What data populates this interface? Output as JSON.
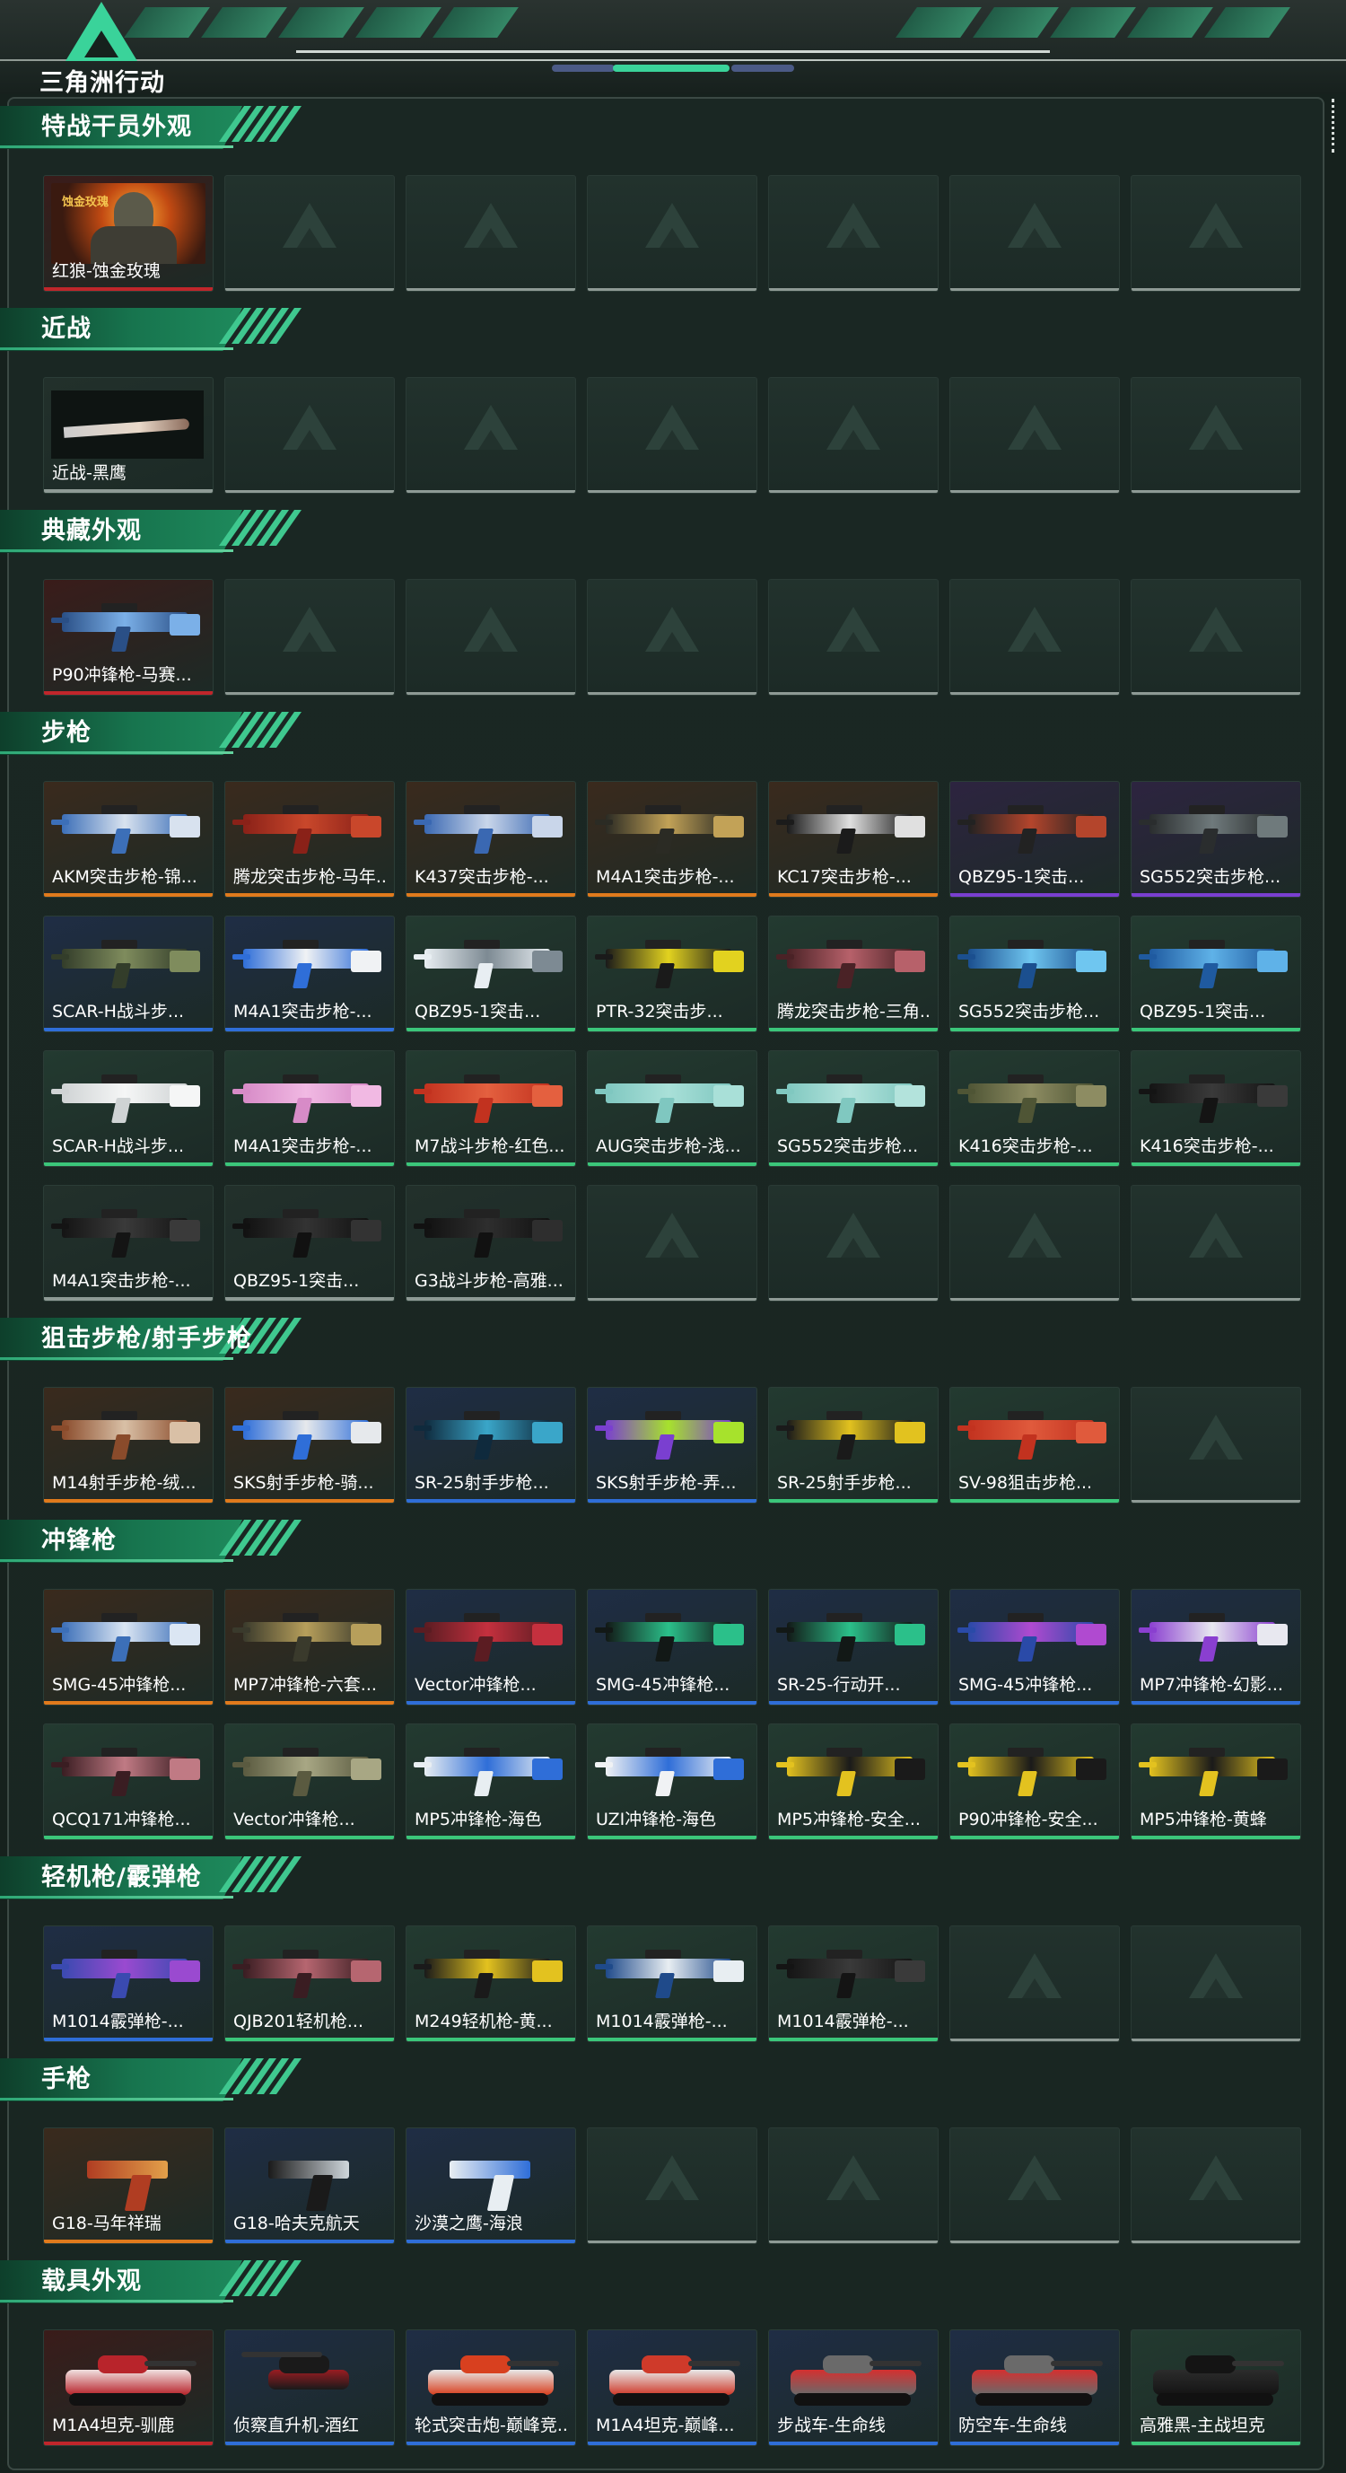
{
  "header": {
    "logo_text": "三角洲行动"
  },
  "colors": {
    "red": "#c0262b",
    "orange": "#e07a1c",
    "purple": "#7a3fd0",
    "blue": "#2f6ed8",
    "green": "#3bc67a",
    "gray": "#8e9a95",
    "accent": "#3ad39a"
  },
  "sections": [
    {
      "title": "特战干员外观",
      "items": [
        {
          "label": "红狼-蚀金玫瑰",
          "rarity": "red",
          "kind": "operator",
          "badge": "蚀金玫瑰"
        }
      ]
    },
    {
      "title": "近战",
      "items": [
        {
          "label": "近战-黑鹰",
          "rarity": "gray",
          "kind": "knife"
        }
      ]
    },
    {
      "title": "典藏外观",
      "items": [
        {
          "label": "P90冲锋枪-马赛...",
          "rarity": "red",
          "kind": "gun",
          "tint": [
            "#2a4f86",
            "#7bb0e8"
          ]
        }
      ]
    },
    {
      "title": "步枪",
      "items": [
        {
          "label": "AKM突击步枪-锦...",
          "rarity": "orange",
          "kind": "gun",
          "tint": [
            "#3c6fb8",
            "#d8e2ef"
          ]
        },
        {
          "label": "腾龙突击步枪-马年...",
          "rarity": "orange",
          "kind": "gun",
          "tint": [
            "#8a2118",
            "#c9472b"
          ]
        },
        {
          "label": "K437突击步枪-...",
          "rarity": "orange",
          "kind": "gun",
          "tint": [
            "#3a68b2",
            "#c9d6ea"
          ]
        },
        {
          "label": "M4A1突击步枪-...",
          "rarity": "orange",
          "kind": "gun",
          "tint": [
            "#2b2b24",
            "#c2a257"
          ]
        },
        {
          "label": "KC17突击步枪-...",
          "rarity": "orange",
          "kind": "gun",
          "tint": [
            "#1b1b1b",
            "#e0e0e0"
          ]
        },
        {
          "label": "QBZ95-1突击...",
          "rarity": "purple",
          "kind": "gun",
          "tint": [
            "#222",
            "#b4452c"
          ]
        },
        {
          "label": "SG552突击步枪...",
          "rarity": "purple",
          "kind": "gun",
          "tint": [
            "#2a2d2e",
            "#6f7a7c"
          ]
        },
        {
          "label": "SCAR-H战斗步...",
          "rarity": "blue",
          "kind": "gun",
          "tint": [
            "#333d2a",
            "#7f8c5d"
          ]
        },
        {
          "label": "M4A1突击步枪-...",
          "rarity": "blue",
          "kind": "gun",
          "tint": [
            "#2f6ed8",
            "#f0f2f4"
          ]
        },
        {
          "label": "QBZ95-1突击...",
          "rarity": "green",
          "kind": "gun",
          "tint": [
            "#e8eef2",
            "#7d8a93"
          ]
        },
        {
          "label": "PTR-32突击步...",
          "rarity": "green",
          "kind": "gun",
          "tint": [
            "#1a1a1a",
            "#e2d21f"
          ]
        },
        {
          "label": "腾龙突击步枪-三角...",
          "rarity": "green",
          "kind": "gun",
          "tint": [
            "#4a2226",
            "#b7616a"
          ]
        },
        {
          "label": "SG552突击步枪...",
          "rarity": "green",
          "kind": "gun",
          "tint": [
            "#1b4f8f",
            "#6fc6f0"
          ]
        },
        {
          "label": "QBZ95-1突击...",
          "rarity": "green",
          "kind": "gun",
          "tint": [
            "#1f5aa0",
            "#5fb2e8"
          ]
        },
        {
          "label": "SCAR-H战斗步...",
          "rarity": "green",
          "kind": "gun",
          "tint": [
            "#cfd3d4",
            "#f5f6f6"
          ]
        },
        {
          "label": "M4A1突击步枪-...",
          "rarity": "green",
          "kind": "gun",
          "tint": [
            "#d78bc7",
            "#f1b9e3"
          ]
        },
        {
          "label": "M7战斗步枪-红色...",
          "rarity": "green",
          "kind": "gun",
          "tint": [
            "#c2321f",
            "#e4603f"
          ]
        },
        {
          "label": "AUG突击步枪-浅...",
          "rarity": "green",
          "kind": "gun",
          "tint": [
            "#7fc7c0",
            "#a9e0d8"
          ]
        },
        {
          "label": "SG552突击步枪...",
          "rarity": "green",
          "kind": "gun",
          "tint": [
            "#80c8c0",
            "#b3e3dc"
          ]
        },
        {
          "label": "K416突击步枪-...",
          "rarity": "green",
          "kind": "gun",
          "tint": [
            "#4f5535",
            "#8d8c62"
          ]
        },
        {
          "label": "K416突击步枪-...",
          "rarity": "green",
          "kind": "gun",
          "tint": [
            "#141414",
            "#3a3a3a"
          ]
        },
        {
          "label": "M4A1突击步枪-...",
          "rarity": "gray",
          "kind": "gun",
          "tint": [
            "#141414",
            "#3a3a3a"
          ]
        },
        {
          "label": "QBZ95-1突击...",
          "rarity": "gray",
          "kind": "gun",
          "tint": [
            "#111",
            "#333"
          ]
        },
        {
          "label": "G3战斗步枪-高雅...",
          "rarity": "gray",
          "kind": "gun",
          "tint": [
            "#111",
            "#2e2e2e"
          ]
        }
      ]
    },
    {
      "title": "狙击步枪/射手步枪",
      "items": [
        {
          "label": "M14射手步枪-绒...",
          "rarity": "orange",
          "kind": "gun",
          "tint": [
            "#8a4b2b",
            "#d9c0a6"
          ]
        },
        {
          "label": "SKS射手步枪-骑...",
          "rarity": "orange",
          "kind": "gun",
          "tint": [
            "#2f6ed8",
            "#e6e9ec"
          ]
        },
        {
          "label": "SR-25射手步枪...",
          "rarity": "blue",
          "kind": "gun",
          "tint": [
            "#0f2a3d",
            "#3aa6c9"
          ]
        },
        {
          "label": "SKS射手步枪-弄...",
          "rarity": "blue",
          "kind": "gun",
          "tint": [
            "#7a3fd0",
            "#a7e22c"
          ]
        },
        {
          "label": "SR-25射手步枪...",
          "rarity": "green",
          "kind": "gun",
          "tint": [
            "#1a1a1a",
            "#e2c21f"
          ]
        },
        {
          "label": "SV-98狙击步枪...",
          "rarity": "green",
          "kind": "gun",
          "tint": [
            "#c2321f",
            "#e05a3c"
          ]
        }
      ]
    },
    {
      "title": "冲锋枪",
      "items": [
        {
          "label": "SMG-45冲锋枪...",
          "rarity": "orange",
          "kind": "gun",
          "tint": [
            "#3c6fb8",
            "#dbe6f3"
          ]
        },
        {
          "label": "MP7冲锋枪-六套...",
          "rarity": "orange",
          "kind": "gun",
          "tint": [
            "#3a3a2c",
            "#b79f5b"
          ]
        },
        {
          "label": "Vector冲锋枪...",
          "rarity": "blue",
          "kind": "gun",
          "tint": [
            "#5b1c22",
            "#c5303e"
          ]
        },
        {
          "label": "SMG-45冲锋枪...",
          "rarity": "blue",
          "kind": "gun",
          "tint": [
            "#121816",
            "#2bc08a"
          ]
        },
        {
          "label": "SR-25-行动开...",
          "rarity": "blue",
          "kind": "gun",
          "tint": [
            "#121816",
            "#2bc08a"
          ]
        },
        {
          "label": "SMG-45冲锋枪...",
          "rarity": "blue",
          "kind": "gun",
          "tint": [
            "#2a4aa8",
            "#b04ad0"
          ]
        },
        {
          "label": "MP7冲锋枪-幻影...",
          "rarity": "blue",
          "kind": "gun",
          "tint": [
            "#8a3fd0",
            "#e8e8f0"
          ]
        },
        {
          "label": "QCQ171冲锋枪...",
          "rarity": "green",
          "kind": "gun",
          "tint": [
            "#3a1d22",
            "#c07a84"
          ]
        },
        {
          "label": "Vector冲锋枪...",
          "rarity": "green",
          "kind": "gun",
          "tint": [
            "#5a5a40",
            "#a8a784"
          ]
        },
        {
          "label": "MP5冲锋枪-海色",
          "rarity": "green",
          "kind": "gun",
          "tint": [
            "#e8eef2",
            "#2f6ed8"
          ]
        },
        {
          "label": "UZI冲锋枪-海色",
          "rarity": "green",
          "kind": "gun",
          "tint": [
            "#f0f2f4",
            "#2f6ed8"
          ]
        },
        {
          "label": "MP5冲锋枪-安全...",
          "rarity": "green",
          "kind": "gun",
          "tint": [
            "#e3c21f",
            "#1a1a1a"
          ]
        },
        {
          "label": "P90冲锋枪-安全...",
          "rarity": "green",
          "kind": "gun",
          "tint": [
            "#e3c21f",
            "#1a1a1a"
          ]
        },
        {
          "label": "MP5冲锋枪-黄蜂",
          "rarity": "green",
          "kind": "gun",
          "tint": [
            "#e3c21f",
            "#1a1a1a"
          ]
        }
      ]
    },
    {
      "title": "轻机枪/霰弹枪",
      "items": [
        {
          "label": "M1014霰弹枪-...",
          "rarity": "blue",
          "kind": "gun",
          "tint": [
            "#3a4ab0",
            "#9a4ad0"
          ]
        },
        {
          "label": "QJB201轻机枪...",
          "rarity": "green",
          "kind": "gun",
          "tint": [
            "#3a1d22",
            "#b66670"
          ]
        },
        {
          "label": "M249轻机枪-黄...",
          "rarity": "green",
          "kind": "gun",
          "tint": [
            "#1a1a1a",
            "#e3c21f"
          ]
        },
        {
          "label": "M1014霰弹枪-...",
          "rarity": "green",
          "kind": "gun",
          "tint": [
            "#1f4a8a",
            "#e8eef2"
          ]
        },
        {
          "label": "M1014霰弹枪-...",
          "rarity": "green",
          "kind": "gun",
          "tint": [
            "#141414",
            "#3a3a3a"
          ]
        }
      ]
    },
    {
      "title": "手枪",
      "items": [
        {
          "label": "G18-马年祥瑞",
          "rarity": "orange",
          "kind": "pistol",
          "tint": [
            "#b03d22",
            "#e2a04a"
          ]
        },
        {
          "label": "G18-哈夫克航天",
          "rarity": "blue",
          "kind": "pistol",
          "tint": [
            "#1a1a1a",
            "#cfd7dc"
          ]
        },
        {
          "label": "沙漠之鹰-海浪",
          "rarity": "blue",
          "kind": "pistol",
          "tint": [
            "#e8eef2",
            "#2f6ed8"
          ]
        }
      ]
    },
    {
      "title": "载具外观",
      "items": [
        {
          "label": "M1A4坦克-驯鹿",
          "rarity": "red",
          "kind": "vehicle",
          "tint": [
            "#b8242b",
            "#f0e0e0"
          ]
        },
        {
          "label": "侦察直升机-酒红",
          "rarity": "blue",
          "kind": "heli",
          "tint": [
            "#1a1a1a",
            "#9a1c22"
          ]
        },
        {
          "label": "轮式突击炮-巅峰竞...",
          "rarity": "blue",
          "kind": "vehicle",
          "tint": [
            "#d8401f",
            "#e8e8e8"
          ]
        },
        {
          "label": "M1A4坦克-巅峰...",
          "rarity": "blue",
          "kind": "vehicle",
          "tint": [
            "#cf3a2a",
            "#e8e8e8"
          ]
        },
        {
          "label": "步战车-生命线",
          "rarity": "blue",
          "kind": "vehicle",
          "tint": [
            "#6a6a6a",
            "#d43030"
          ]
        },
        {
          "label": "防空车-生命线",
          "rarity": "blue",
          "kind": "vehicle",
          "tint": [
            "#6a6a6a",
            "#d43030"
          ]
        },
        {
          "label": "高雅黑-主战坦克",
          "rarity": "green",
          "kind": "vehicle",
          "tint": [
            "#141414",
            "#2c2c2c"
          ]
        }
      ]
    }
  ]
}
